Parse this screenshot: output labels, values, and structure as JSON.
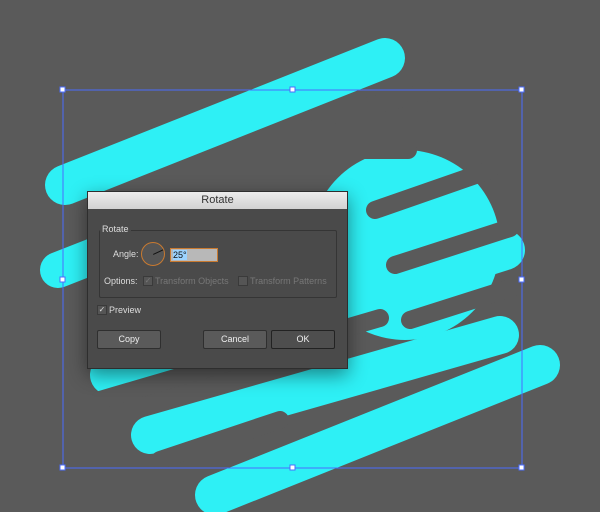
{
  "colors": {
    "canvas": "#5a5a5a",
    "shape": "#2ef0f5",
    "selection": "#4b6cff"
  },
  "dialog": {
    "title": "Rotate",
    "group_label": "Rotate",
    "angle_label": "Angle:",
    "angle_value": "25°",
    "options_label": "Options:",
    "transform_objects": "Transform Objects",
    "transform_patterns": "Transform Patterns",
    "preview": "Preview",
    "copy": "Copy",
    "cancel": "Cancel",
    "ok": "OK",
    "check": "✓"
  }
}
